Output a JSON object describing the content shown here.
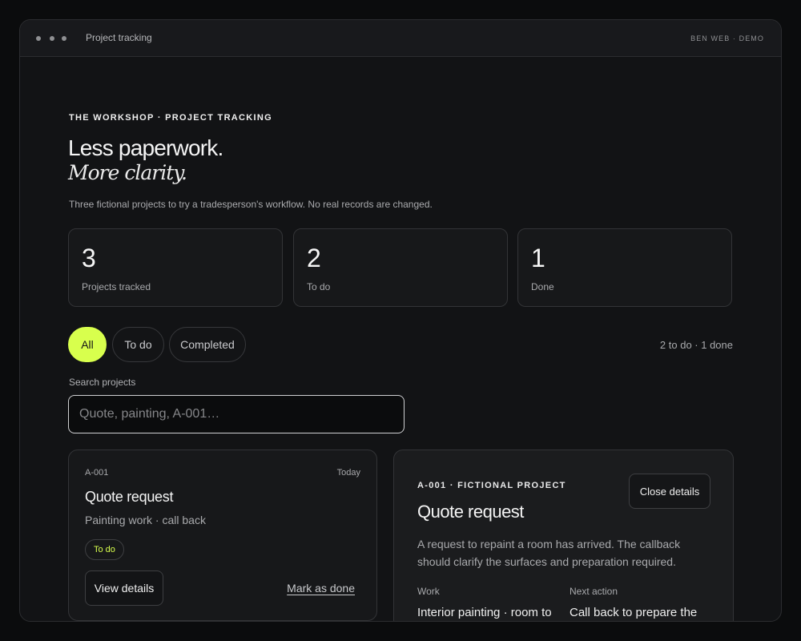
{
  "window": {
    "title": "Project tracking",
    "badge": "BEN WEB · DEMO"
  },
  "hero": {
    "eyebrow": "THE WORKSHOP · PROJECT TRACKING",
    "title": "Less paperwork.",
    "title_italic": "More clarity.",
    "lead": "Three fictional projects to try a tradesperson's workflow. No real records are changed."
  },
  "stats": [
    {
      "value": "3",
      "label": "Projects tracked"
    },
    {
      "value": "2",
      "label": "To do"
    },
    {
      "value": "1",
      "label": "Done"
    }
  ],
  "filters": {
    "items": [
      {
        "label": "All",
        "active": true
      },
      {
        "label": "To do",
        "active": false
      },
      {
        "label": "Completed",
        "active": false
      }
    ],
    "summary": "2 to do · 1 done"
  },
  "search": {
    "label": "Search projects",
    "placeholder": "Quote, painting, A-001…",
    "value": ""
  },
  "card": {
    "id": "A-001",
    "date": "Today",
    "title": "Quote request",
    "subtitle": "Painting work · call back",
    "status": "To do",
    "view_label": "View details",
    "done_label": "Mark as done"
  },
  "detail": {
    "eyebrow": "A-001 · FICTIONAL PROJECT",
    "close_label": "Close details",
    "title": "Quote request",
    "description": "A request to repaint a room has arrived. The callback should clarify the surfaces and preparation required.",
    "work_label": "Work",
    "work_value": "Interior painting · room to",
    "next_label": "Next action",
    "next_value": "Call back to prepare the"
  },
  "colors": {
    "accent": "#d8ff4d",
    "background": "#0b0c0d",
    "panel": "#121315"
  }
}
